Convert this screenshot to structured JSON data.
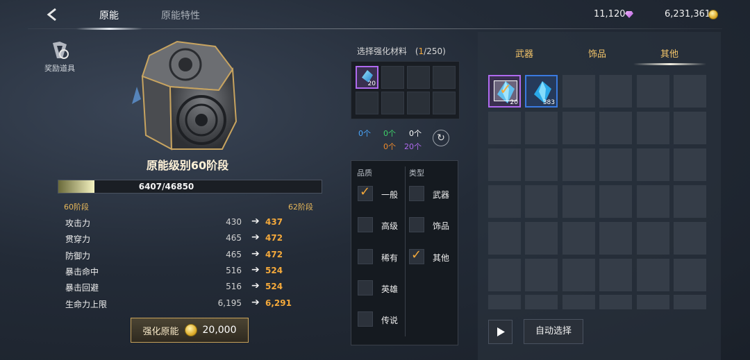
{
  "header": {
    "tabs": [
      {
        "label": "原能",
        "active": true
      },
      {
        "label": "原能特性",
        "active": false
      }
    ],
    "currencies": [
      {
        "icon": "diamond-icon",
        "value": "11,120",
        "color": "#c06ae0"
      },
      {
        "icon": "gold-coin-icon",
        "value": "6,231,361",
        "color": "#e0b030"
      }
    ]
  },
  "reward": {
    "label": "奖励道具",
    "icon": "reward-icon"
  },
  "core": {
    "level_title": "原能级别60阶段",
    "xp_text": "6407/46850",
    "xp_progress": 0.137,
    "stage_current": "60阶段",
    "stage_next": "62阶段"
  },
  "stats": [
    {
      "name": "攻击力",
      "old": "430",
      "new": "437"
    },
    {
      "name": "贯穿力",
      "old": "465",
      "new": "472"
    },
    {
      "name": "防御力",
      "old": "465",
      "new": "472"
    },
    {
      "name": "暴击命中",
      "old": "516",
      "new": "524"
    },
    {
      "name": "暴击回避",
      "old": "516",
      "new": "524"
    },
    {
      "name": "生命力上限",
      "old": "6,195",
      "new": "6,291"
    }
  ],
  "enhance_button": {
    "label": "强化原能",
    "cost": "20,000"
  },
  "materials": {
    "title": "选择强化材料",
    "count_current": "1",
    "count_total": "/250)",
    "count_open": "(",
    "first_slot_qty": "20",
    "counts": [
      {
        "value": "0个",
        "color": "#4aa8ff"
      },
      {
        "value": "0个",
        "color": "#3ed36a"
      },
      {
        "value": "0个",
        "color": "#ffffff"
      },
      {
        "value": "0个",
        "color": "#f08a2a"
      },
      {
        "value": "20个",
        "color": "#b06af0"
      }
    ]
  },
  "filters": {
    "quality_header": "品质",
    "type_header": "类型",
    "quality": [
      {
        "label": "一般",
        "checked": true
      },
      {
        "label": "高级",
        "checked": false
      },
      {
        "label": "稀有",
        "checked": false
      },
      {
        "label": "英雄",
        "checked": false
      },
      {
        "label": "传说",
        "checked": false
      }
    ],
    "type": [
      {
        "label": "武器",
        "checked": false
      },
      {
        "label": "饰品",
        "checked": false
      },
      {
        "label": "其他",
        "checked": true
      }
    ]
  },
  "inventory": {
    "tabs": [
      {
        "label": "武器",
        "active": false
      },
      {
        "label": "饰品",
        "active": false
      },
      {
        "label": "其他",
        "active": true
      }
    ],
    "items": [
      {
        "icon": "blue-crystal-icon",
        "qty": "20",
        "selected": true,
        "border": "#b06af0"
      },
      {
        "icon": "blue-crystal-icon",
        "qty": "383",
        "selected": false,
        "border": "#3a7ae0"
      }
    ],
    "auto_select_label": "自动选择"
  }
}
